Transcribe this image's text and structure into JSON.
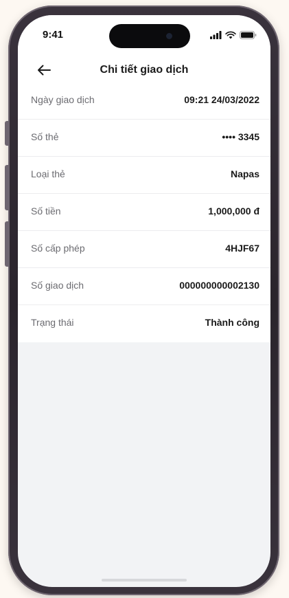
{
  "status_bar": {
    "time": "9:41",
    "icons": [
      "signal-icon",
      "wifi-icon",
      "battery-icon"
    ]
  },
  "header": {
    "back_icon": "arrow-left-icon",
    "title": "Chi tiết giao dịch"
  },
  "details": [
    {
      "label": "Ngày giao dịch",
      "value": "09:21 24/03/2022"
    },
    {
      "label": "Số thẻ",
      "value": "•••• 3345"
    },
    {
      "label": "Loại thẻ",
      "value": "Napas"
    },
    {
      "label": "Số tiền",
      "value": "1,000,000 đ"
    },
    {
      "label": "Số cấp phép",
      "value": "4HJF67"
    },
    {
      "label": "Số giao dịch",
      "value": "000000000002130"
    },
    {
      "label": "Trạng thái",
      "value": "Thành công"
    }
  ],
  "colors": {
    "background": "#f2f3f5",
    "card": "#ffffff",
    "label": "#6b6b70",
    "value": "#1a1a1a"
  }
}
